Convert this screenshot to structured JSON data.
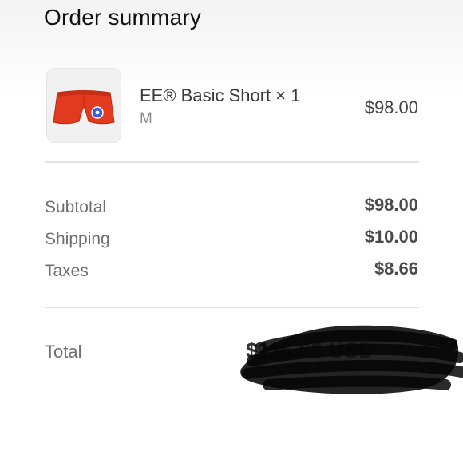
{
  "header": {
    "title": "Order summary"
  },
  "product": {
    "name": "EE® Basic Short × 1",
    "variant": "M",
    "price": "$98.00",
    "thumbnail_icon": "shorts-icon",
    "shorts_color": "#e23a1f"
  },
  "totals": {
    "subtotal_label": "Subtotal",
    "subtotal_value": "$98.00",
    "shipping_label": "Shipping",
    "shipping_value": "$10.00",
    "taxes_label": "Taxes",
    "taxes_value": "$8.66"
  },
  "total": {
    "label": "Total",
    "value": "$116.66 USD"
  }
}
